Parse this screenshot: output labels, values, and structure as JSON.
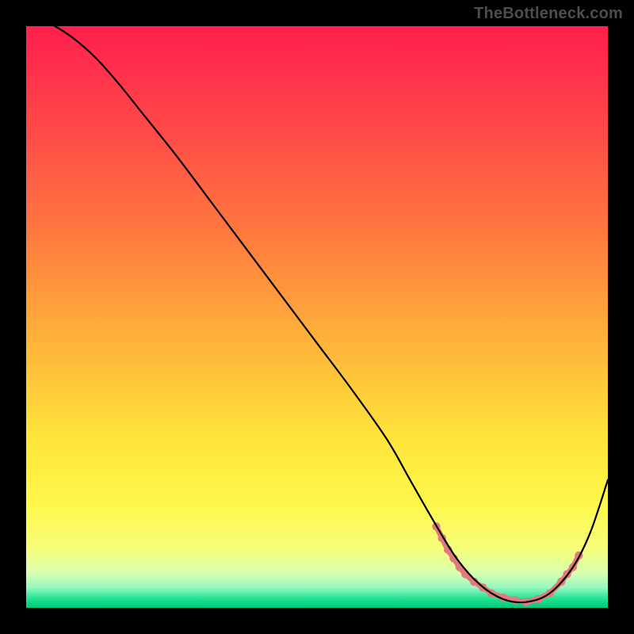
{
  "watermark": "TheBottleneck.com",
  "chart_data": {
    "type": "line",
    "title": "",
    "xlabel": "",
    "ylabel": "",
    "xlim": [
      0,
      100
    ],
    "ylim": [
      0,
      100
    ],
    "grid": false,
    "legend": false,
    "background_gradient": {
      "type": "vertical",
      "stops": [
        {
          "pos": 0.0,
          "color": "#ff1f4d"
        },
        {
          "pos": 0.18,
          "color": "#ff4a47"
        },
        {
          "pos": 0.36,
          "color": "#ff7a3e"
        },
        {
          "pos": 0.54,
          "color": "#ffb23a"
        },
        {
          "pos": 0.7,
          "color": "#ffe33a"
        },
        {
          "pos": 0.82,
          "color": "#fff74a"
        },
        {
          "pos": 0.9,
          "color": "#f6ff7a"
        },
        {
          "pos": 0.94,
          "color": "#d8ffb0"
        },
        {
          "pos": 0.965,
          "color": "#96f8c0"
        },
        {
          "pos": 0.985,
          "color": "#1de28f"
        },
        {
          "pos": 1.0,
          "color": "#00c87a"
        }
      ]
    },
    "series": [
      {
        "name": "bottleneck-curve",
        "color": "#000000",
        "x": [
          0.0,
          4.0,
          8.0,
          12.0,
          16.0,
          20.0,
          26.0,
          32.0,
          38.0,
          44.0,
          50.0,
          56.0,
          62.0,
          66.0,
          70.0,
          74.0,
          78.0,
          82.0,
          86.0,
          90.0,
          94.0,
          97.0,
          100.0
        ],
        "y": [
          102.0,
          100.5,
          98.0,
          94.5,
          90.0,
          85.0,
          77.5,
          69.5,
          61.5,
          53.5,
          45.5,
          37.5,
          29.0,
          22.0,
          15.0,
          8.5,
          4.0,
          1.5,
          1.0,
          2.5,
          7.0,
          13.0,
          22.0
        ]
      }
    ],
    "markers": {
      "name": "highlight-band",
      "color": "#e27b7d",
      "points": [
        {
          "x": 70.5,
          "y": 14.0
        },
        {
          "x": 71.5,
          "y": 12.0
        },
        {
          "x": 72.5,
          "y": 10.0
        },
        {
          "x": 73.5,
          "y": 8.5
        },
        {
          "x": 74.5,
          "y": 7.0
        },
        {
          "x": 75.5,
          "y": 5.8
        },
        {
          "x": 77.0,
          "y": 4.5
        },
        {
          "x": 78.5,
          "y": 3.5
        },
        {
          "x": 80.0,
          "y": 2.5
        },
        {
          "x": 82.0,
          "y": 1.8
        },
        {
          "x": 84.0,
          "y": 1.3
        },
        {
          "x": 86.0,
          "y": 1.0
        },
        {
          "x": 88.0,
          "y": 1.5
        },
        {
          "x": 90.0,
          "y": 2.5
        },
        {
          "x": 92.0,
          "y": 4.5
        },
        {
          "x": 93.0,
          "y": 5.8
        },
        {
          "x": 94.0,
          "y": 7.0
        },
        {
          "x": 95.0,
          "y": 9.0
        }
      ]
    }
  }
}
